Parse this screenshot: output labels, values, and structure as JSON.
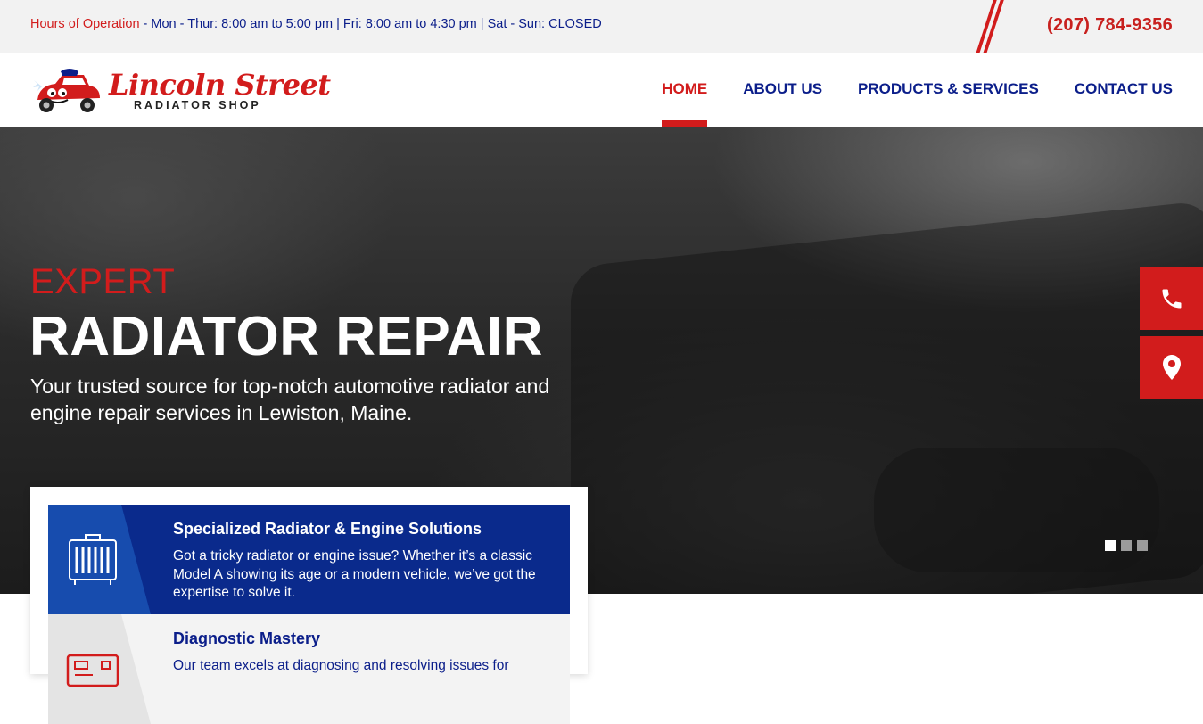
{
  "topbar": {
    "hours_label": "Hours of Operation",
    "hours_text": " - Mon - Thur: 8:00 am to 5:00 pm | Fri: 8:00 am to 4:30 pm | Sat - Sun: CLOSED",
    "phone": "(207) 784-9356"
  },
  "brand": {
    "name": "Lincoln Street",
    "tagline": "RADIATOR SHOP"
  },
  "nav": {
    "items": [
      {
        "label": "HOME",
        "active": true
      },
      {
        "label": "ABOUT US",
        "active": false
      },
      {
        "label": "PRODUCTS & SERVICES",
        "active": false
      },
      {
        "label": "CONTACT US",
        "active": false
      }
    ]
  },
  "hero": {
    "eyebrow": "EXPERT",
    "title": "RADIATOR REPAIR",
    "description": "Your trusted source for top-notch automotive radiator and engine repair services in Lewiston, Maine.",
    "slides_total": 3,
    "active_slide": 1
  },
  "floating_actions": [
    {
      "icon": "phone-icon"
    },
    {
      "icon": "map-pin-icon"
    }
  ],
  "services": [
    {
      "icon": "radiator-icon",
      "title": "Specialized Radiator & Engine Solutions",
      "text": "Got a tricky radiator or engine issue? Whether it’s a classic Model A showing its age or a modern vehicle, we’ve got the expertise to solve it."
    },
    {
      "icon": "diagnostic-icon",
      "title": "Diagnostic Mastery",
      "text": "Our team excels at diagnosing and resolving issues for"
    }
  ],
  "colors": {
    "accent_red": "#d21c1c",
    "navy": "#0b1e8a",
    "card_blue": "#0a2a8c"
  }
}
